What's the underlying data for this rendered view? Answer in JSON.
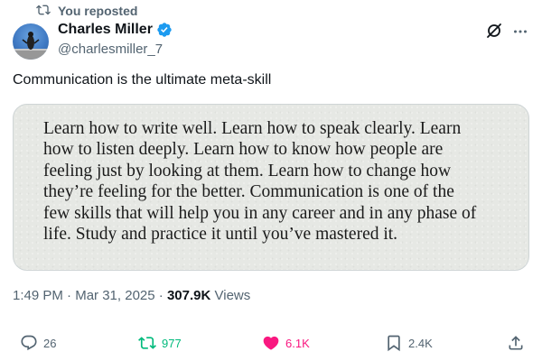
{
  "repost": {
    "label": "You reposted",
    "icon": "retweet-icon"
  },
  "author": {
    "name": "Charles Miller",
    "handle": "@charlesmiller_7",
    "verified": true,
    "avatar": "avatar"
  },
  "tweet": {
    "text": "Communication is the ultimate meta-skill",
    "quote_lines": [
      "Learn how to write well. Learn how to speak clearly. Learn",
      "how to listen deeply. Learn how to know how people are",
      "feeling just by looking at them. Learn how to change how",
      "they’re feeling for the better. Communication is one of the",
      "few skills that will help you in any career and in any phase of",
      "life. Study and practice it until you’ve mastered it."
    ]
  },
  "meta": {
    "time": "1:49 PM",
    "separator": "·",
    "date": "Mar 31, 2025",
    "views_count": "307.9K",
    "views_label": "Views"
  },
  "actions": {
    "replies": "26",
    "reposts": "977",
    "likes": "6.1K",
    "bookmarks": "2.4K"
  },
  "colors": {
    "text": "#0f1419",
    "secondary": "#536471",
    "verified": "#1d9bf0",
    "repost_active": "#00ba7c",
    "like_active": "#f91880"
  },
  "icons": {
    "grok": "grok-icon",
    "more": "more-icon",
    "reply": "reply-icon",
    "repost": "retweet-icon",
    "like": "heart-icon",
    "bookmark": "bookmark-icon",
    "share": "share-icon"
  }
}
